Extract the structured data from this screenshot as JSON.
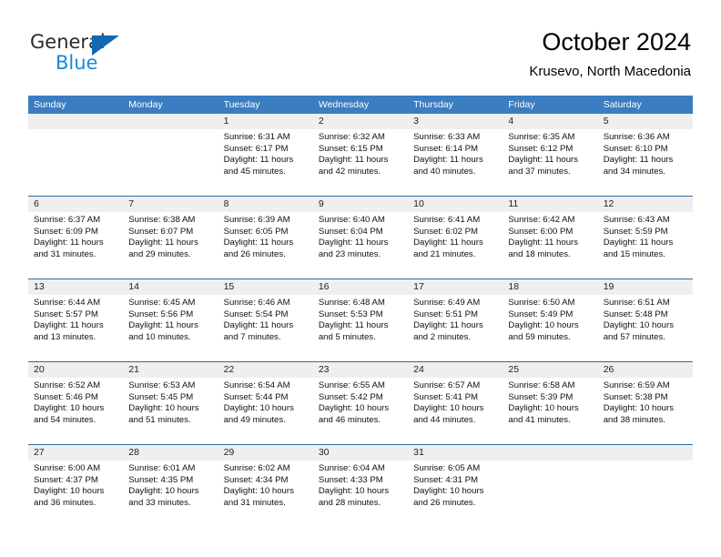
{
  "branding": {
    "word_general": "General",
    "word_blue": "Blue",
    "triangle_color": "#1268b3",
    "blue_text_color": "#1b87d8"
  },
  "header": {
    "title": "October 2024",
    "subtitle": "Krusevo, North Macedonia"
  },
  "theme": {
    "header_blue": "#3b7dc0",
    "week_divider": "#2e6da4",
    "date_band": "#efefef",
    "text": "#111111"
  },
  "calendar": {
    "day_headers": [
      "Sunday",
      "Monday",
      "Tuesday",
      "Wednesday",
      "Thursday",
      "Friday",
      "Saturday"
    ],
    "weeks": [
      [
        {
          "date": "",
          "lines": []
        },
        {
          "date": "",
          "lines": []
        },
        {
          "date": "1",
          "lines": [
            "Sunrise: 6:31 AM",
            "Sunset: 6:17 PM",
            "Daylight: 11 hours",
            "and 45 minutes."
          ]
        },
        {
          "date": "2",
          "lines": [
            "Sunrise: 6:32 AM",
            "Sunset: 6:15 PM",
            "Daylight: 11 hours",
            "and 42 minutes."
          ]
        },
        {
          "date": "3",
          "lines": [
            "Sunrise: 6:33 AM",
            "Sunset: 6:14 PM",
            "Daylight: 11 hours",
            "and 40 minutes."
          ]
        },
        {
          "date": "4",
          "lines": [
            "Sunrise: 6:35 AM",
            "Sunset: 6:12 PM",
            "Daylight: 11 hours",
            "and 37 minutes."
          ]
        },
        {
          "date": "5",
          "lines": [
            "Sunrise: 6:36 AM",
            "Sunset: 6:10 PM",
            "Daylight: 11 hours",
            "and 34 minutes."
          ]
        }
      ],
      [
        {
          "date": "6",
          "lines": [
            "Sunrise: 6:37 AM",
            "Sunset: 6:09 PM",
            "Daylight: 11 hours",
            "and 31 minutes."
          ]
        },
        {
          "date": "7",
          "lines": [
            "Sunrise: 6:38 AM",
            "Sunset: 6:07 PM",
            "Daylight: 11 hours",
            "and 29 minutes."
          ]
        },
        {
          "date": "8",
          "lines": [
            "Sunrise: 6:39 AM",
            "Sunset: 6:05 PM",
            "Daylight: 11 hours",
            "and 26 minutes."
          ]
        },
        {
          "date": "9",
          "lines": [
            "Sunrise: 6:40 AM",
            "Sunset: 6:04 PM",
            "Daylight: 11 hours",
            "and 23 minutes."
          ]
        },
        {
          "date": "10",
          "lines": [
            "Sunrise: 6:41 AM",
            "Sunset: 6:02 PM",
            "Daylight: 11 hours",
            "and 21 minutes."
          ]
        },
        {
          "date": "11",
          "lines": [
            "Sunrise: 6:42 AM",
            "Sunset: 6:00 PM",
            "Daylight: 11 hours",
            "and 18 minutes."
          ]
        },
        {
          "date": "12",
          "lines": [
            "Sunrise: 6:43 AM",
            "Sunset: 5:59 PM",
            "Daylight: 11 hours",
            "and 15 minutes."
          ]
        }
      ],
      [
        {
          "date": "13",
          "lines": [
            "Sunrise: 6:44 AM",
            "Sunset: 5:57 PM",
            "Daylight: 11 hours",
            "and 13 minutes."
          ]
        },
        {
          "date": "14",
          "lines": [
            "Sunrise: 6:45 AM",
            "Sunset: 5:56 PM",
            "Daylight: 11 hours",
            "and 10 minutes."
          ]
        },
        {
          "date": "15",
          "lines": [
            "Sunrise: 6:46 AM",
            "Sunset: 5:54 PM",
            "Daylight: 11 hours",
            "and 7 minutes."
          ]
        },
        {
          "date": "16",
          "lines": [
            "Sunrise: 6:48 AM",
            "Sunset: 5:53 PM",
            "Daylight: 11 hours",
            "and 5 minutes."
          ]
        },
        {
          "date": "17",
          "lines": [
            "Sunrise: 6:49 AM",
            "Sunset: 5:51 PM",
            "Daylight: 11 hours",
            "and 2 minutes."
          ]
        },
        {
          "date": "18",
          "lines": [
            "Sunrise: 6:50 AM",
            "Sunset: 5:49 PM",
            "Daylight: 10 hours",
            "and 59 minutes."
          ]
        },
        {
          "date": "19",
          "lines": [
            "Sunrise: 6:51 AM",
            "Sunset: 5:48 PM",
            "Daylight: 10 hours",
            "and 57 minutes."
          ]
        }
      ],
      [
        {
          "date": "20",
          "lines": [
            "Sunrise: 6:52 AM",
            "Sunset: 5:46 PM",
            "Daylight: 10 hours",
            "and 54 minutes."
          ]
        },
        {
          "date": "21",
          "lines": [
            "Sunrise: 6:53 AM",
            "Sunset: 5:45 PM",
            "Daylight: 10 hours",
            "and 51 minutes."
          ]
        },
        {
          "date": "22",
          "lines": [
            "Sunrise: 6:54 AM",
            "Sunset: 5:44 PM",
            "Daylight: 10 hours",
            "and 49 minutes."
          ]
        },
        {
          "date": "23",
          "lines": [
            "Sunrise: 6:55 AM",
            "Sunset: 5:42 PM",
            "Daylight: 10 hours",
            "and 46 minutes."
          ]
        },
        {
          "date": "24",
          "lines": [
            "Sunrise: 6:57 AM",
            "Sunset: 5:41 PM",
            "Daylight: 10 hours",
            "and 44 minutes."
          ]
        },
        {
          "date": "25",
          "lines": [
            "Sunrise: 6:58 AM",
            "Sunset: 5:39 PM",
            "Daylight: 10 hours",
            "and 41 minutes."
          ]
        },
        {
          "date": "26",
          "lines": [
            "Sunrise: 6:59 AM",
            "Sunset: 5:38 PM",
            "Daylight: 10 hours",
            "and 38 minutes."
          ]
        }
      ],
      [
        {
          "date": "27",
          "lines": [
            "Sunrise: 6:00 AM",
            "Sunset: 4:37 PM",
            "Daylight: 10 hours",
            "and 36 minutes."
          ]
        },
        {
          "date": "28",
          "lines": [
            "Sunrise: 6:01 AM",
            "Sunset: 4:35 PM",
            "Daylight: 10 hours",
            "and 33 minutes."
          ]
        },
        {
          "date": "29",
          "lines": [
            "Sunrise: 6:02 AM",
            "Sunset: 4:34 PM",
            "Daylight: 10 hours",
            "and 31 minutes."
          ]
        },
        {
          "date": "30",
          "lines": [
            "Sunrise: 6:04 AM",
            "Sunset: 4:33 PM",
            "Daylight: 10 hours",
            "and 28 minutes."
          ]
        },
        {
          "date": "31",
          "lines": [
            "Sunrise: 6:05 AM",
            "Sunset: 4:31 PM",
            "Daylight: 10 hours",
            "and 26 minutes."
          ]
        },
        {
          "date": "",
          "lines": []
        },
        {
          "date": "",
          "lines": []
        }
      ]
    ]
  }
}
